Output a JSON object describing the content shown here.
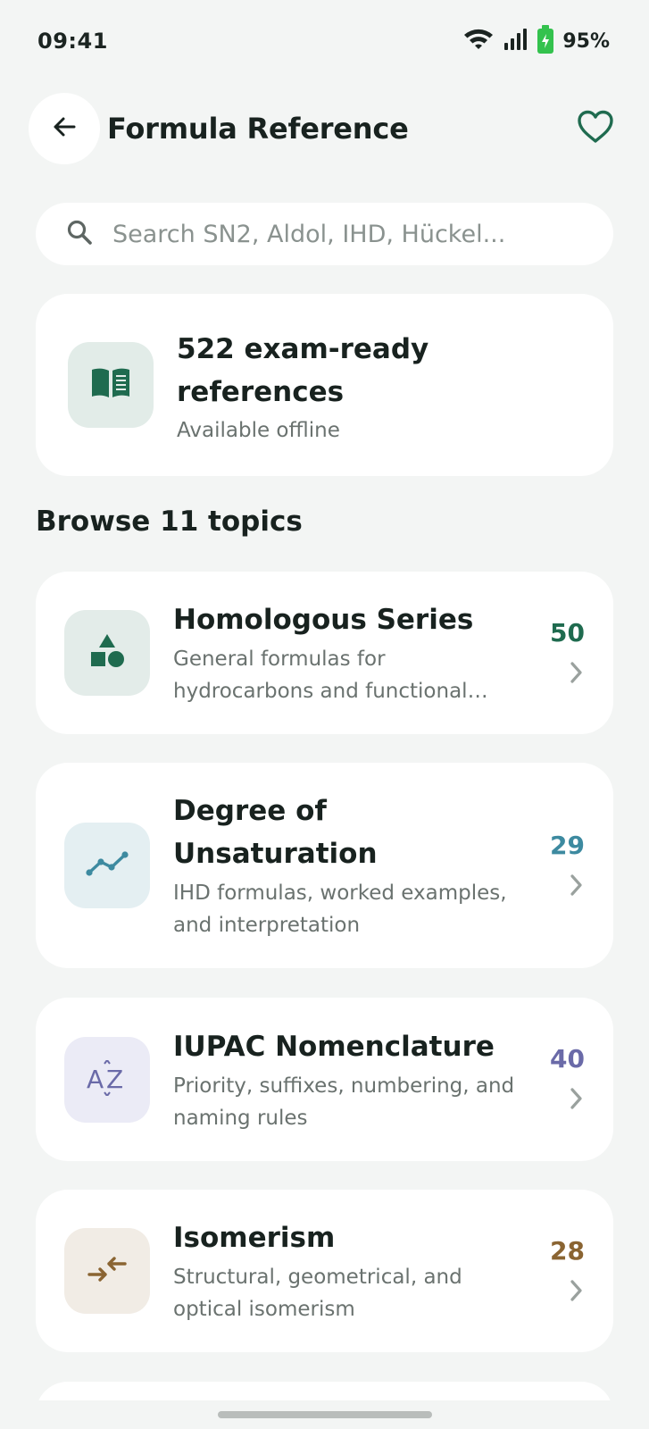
{
  "status_bar": {
    "time": "09:41",
    "battery": "95%"
  },
  "header": {
    "title": "Formula Reference"
  },
  "search": {
    "placeholder": "Search SN2, Aldol, IHD, Hückel..."
  },
  "summary": {
    "title": "522 exam-ready references",
    "subtitle": "Available offline"
  },
  "browse": {
    "heading": "Browse 11 topics"
  },
  "topics": [
    {
      "title": "Homologous Series",
      "description": "General formulas for hydrocarbons and functional groups",
      "count": "50",
      "icon": "shapes-icon",
      "accent": "#1f6b4f",
      "icon_bg": "#e3ece9"
    },
    {
      "title": "Degree of Unsaturation",
      "description": "IHD formulas, worked examples, and interpretation",
      "count": "29",
      "icon": "trend-line-icon",
      "accent": "#3d8aa0",
      "icon_bg": "#e4eff2"
    },
    {
      "title": "IUPAC Nomenclature",
      "description": "Priority, suffixes, numbering, and naming rules",
      "count": "40",
      "icon": "sort-az-icon",
      "accent": "#6a6aa8",
      "icon_bg": "#ebebf6"
    },
    {
      "title": "Isomerism",
      "description": "Structural, geometrical, and optical isomerism",
      "count": "28",
      "icon": "swap-arrows-icon",
      "accent": "#8a6432",
      "icon_bg": "#f1ece5"
    }
  ]
}
